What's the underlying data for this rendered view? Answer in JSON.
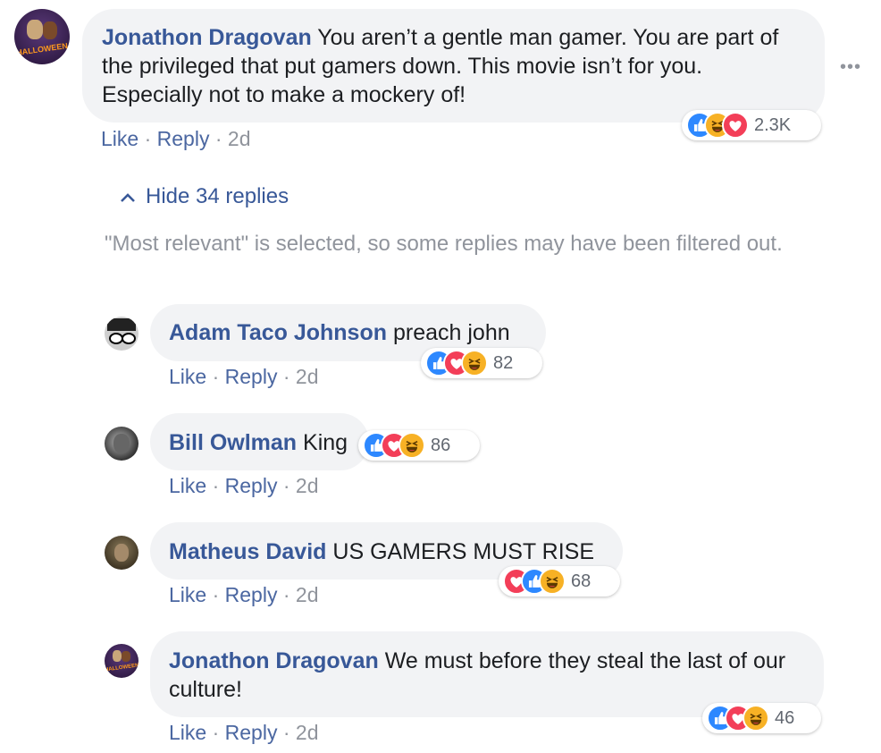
{
  "main_comment": {
    "author": "Jonathon Dragovan",
    "text": "You aren’t a gentle man gamer. You are part of the privileged that put gamers down. This movie isn’t for you. Especially not to make a mockery of!",
    "avatar_text": "HALLOWEEN",
    "reaction_count": "2.3K",
    "like_label": "Like",
    "reply_label": "Reply",
    "time": "2d",
    "more_label": "•••"
  },
  "replies_toggle": {
    "icon": "chevron-up-icon",
    "label": "Hide 34 replies"
  },
  "filter_notice": "\"Most relevant\" is selected, so some replies may have been filtered out.",
  "replies": [
    {
      "author": "Adam Taco Johnson",
      "text": "preach john",
      "reaction_count": "82",
      "like_label": "Like",
      "reply_label": "Reply",
      "time": "2d"
    },
    {
      "author": "Bill Owlman",
      "text": "King",
      "reaction_count": "86",
      "like_label": "Like",
      "reply_label": "Reply",
      "time": "2d"
    },
    {
      "author": "Matheus David",
      "text": "US GAMERS MUST RISE",
      "reaction_count": "68",
      "like_label": "Like",
      "reply_label": "Reply",
      "time": "2d"
    },
    {
      "author": "Jonathon Dragovan",
      "text": "We must before they steal the last of our culture!",
      "avatar_text": "HALLOWEEN",
      "reaction_count": "46",
      "like_label": "Like",
      "reply_label": "Reply",
      "time": "2d"
    }
  ],
  "colors": {
    "author": "#385898",
    "bubble": "#f2f3f5",
    "like": "#2d88ff",
    "love": "#f33e58",
    "haha": "#f7b125"
  }
}
